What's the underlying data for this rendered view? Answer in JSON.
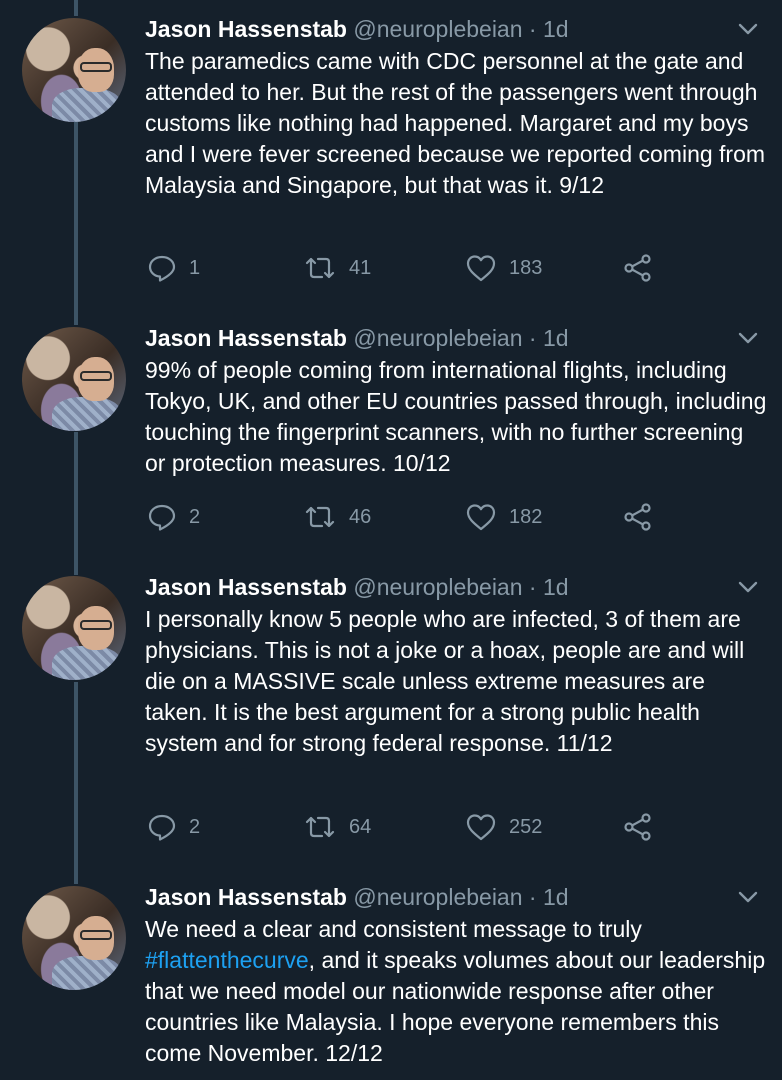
{
  "tweets": [
    {
      "name": "Jason Hassenstab",
      "handle": "@neuroplebeian",
      "time": "1d",
      "text": "The paramedics came with CDC personnel at the gate and attended to her. But the rest of the passengers went through customs like nothing had happened. Margaret and my boys and I were fever screened because we reported coming from Malaysia and Singapore, but that was it. 9/12",
      "replies": "1",
      "retweets": "41",
      "likes": "183"
    },
    {
      "name": "Jason Hassenstab",
      "handle": "@neuroplebeian",
      "time": "1d",
      "text": "99% of people coming from international flights, including Tokyo, UK, and other EU countries passed through, including touching the fingerprint scanners, with no further screening or protection measures. 10/12",
      "replies": "2",
      "retweets": "46",
      "likes": "182"
    },
    {
      "name": "Jason Hassenstab",
      "handle": "@neuroplebeian",
      "time": "1d",
      "text": "I personally know 5 people who are infected, 3 of them are physicians. This is not a joke or a hoax, people are and will die on a MASSIVE scale unless extreme measures are taken. It is the best argument for a strong public health system and for strong federal response. 11/12",
      "replies": "2",
      "retweets": "64",
      "likes": "252"
    },
    {
      "name": "Jason Hassenstab",
      "handle": "@neuroplebeian",
      "time": "1d",
      "text_before": "We need a clear and consistent message to truly ",
      "hashtag": "#flattenthecurve",
      "text_after": ", and it speaks volumes about our leadership that we need model our nationwide response after other countries like Malaysia. I hope everyone remembers this come November. 12/12"
    }
  ],
  "separator": "·",
  "icons": {
    "reply": "reply-icon",
    "retweet": "retweet-icon",
    "like": "heart-icon",
    "share": "share-icon",
    "more": "chevron-down-icon"
  },
  "colors": {
    "background": "#15202b",
    "muted": "#8899a6",
    "link": "#1da1f2",
    "thread": "#3d5466"
  }
}
